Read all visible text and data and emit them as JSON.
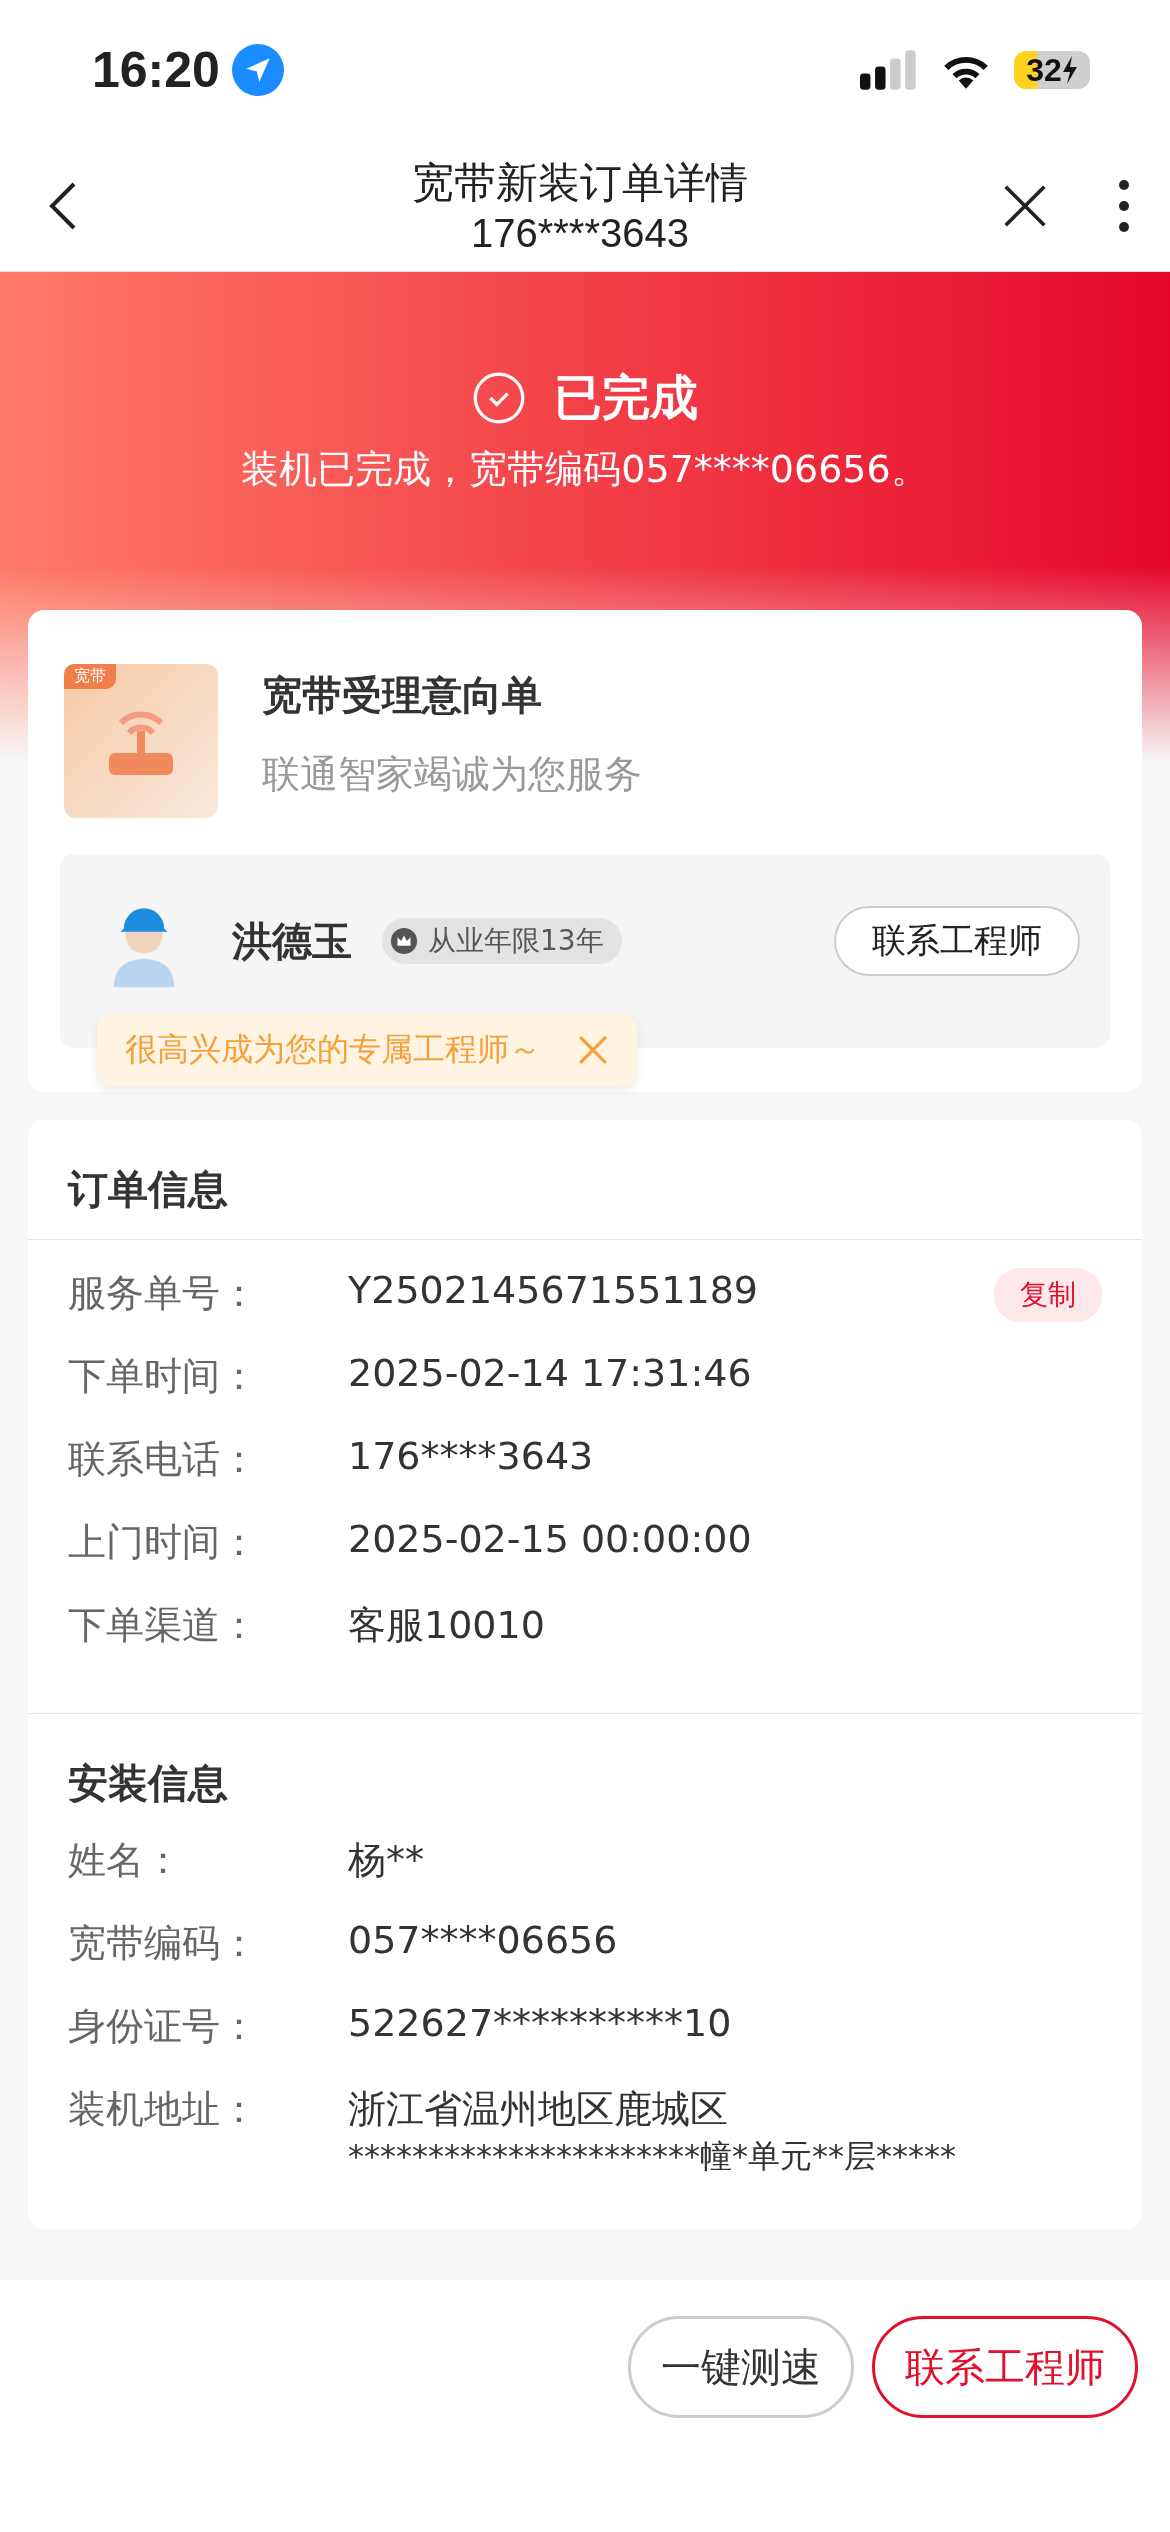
{
  "status_bar": {
    "time": "16:20",
    "battery": "32"
  },
  "header": {
    "title": "宽带新装订单详情",
    "subtitle": "176****3643"
  },
  "status": {
    "title": "已完成",
    "message": "装机已完成，宽带编码057****06656。"
  },
  "product": {
    "badge": "宽带",
    "title": "宽带受理意向单",
    "subtitle": "联通智家竭诚为您服务"
  },
  "engineer": {
    "name": "洪德玉",
    "experience": "从业年限13年",
    "contact_button": "联系工程师",
    "tooltip": "很高兴成为您的专属工程师～"
  },
  "order_info": {
    "title": "订单信息",
    "rows": [
      {
        "label": "服务单号：",
        "value": "Y2502145671551189",
        "action": "复制"
      },
      {
        "label": "下单时间：",
        "value": "2025-02-14 17:31:46"
      },
      {
        "label": "联系电话：",
        "value": "176****3643"
      },
      {
        "label": "上门时间：",
        "value": "2025-02-15 00:00:00"
      },
      {
        "label": "下单渠道：",
        "value": "客服10010"
      }
    ]
  },
  "install_info": {
    "title": "安装信息",
    "rows": [
      {
        "label": "姓名：",
        "lines": [
          "杨**"
        ]
      },
      {
        "label": "宽带编码：",
        "lines": [
          "057****06656"
        ]
      },
      {
        "label": "身份证号：",
        "lines": [
          "522627**********10"
        ]
      },
      {
        "label": "装机地址：",
        "lines": [
          "浙江省温州地区鹿城区",
          "**********************幢*单元**层*****"
        ]
      }
    ]
  },
  "bottom_buttons": [
    {
      "label": "一键测速",
      "kind": "outline"
    },
    {
      "label": "联系工程师",
      "kind": "primary"
    }
  ]
}
